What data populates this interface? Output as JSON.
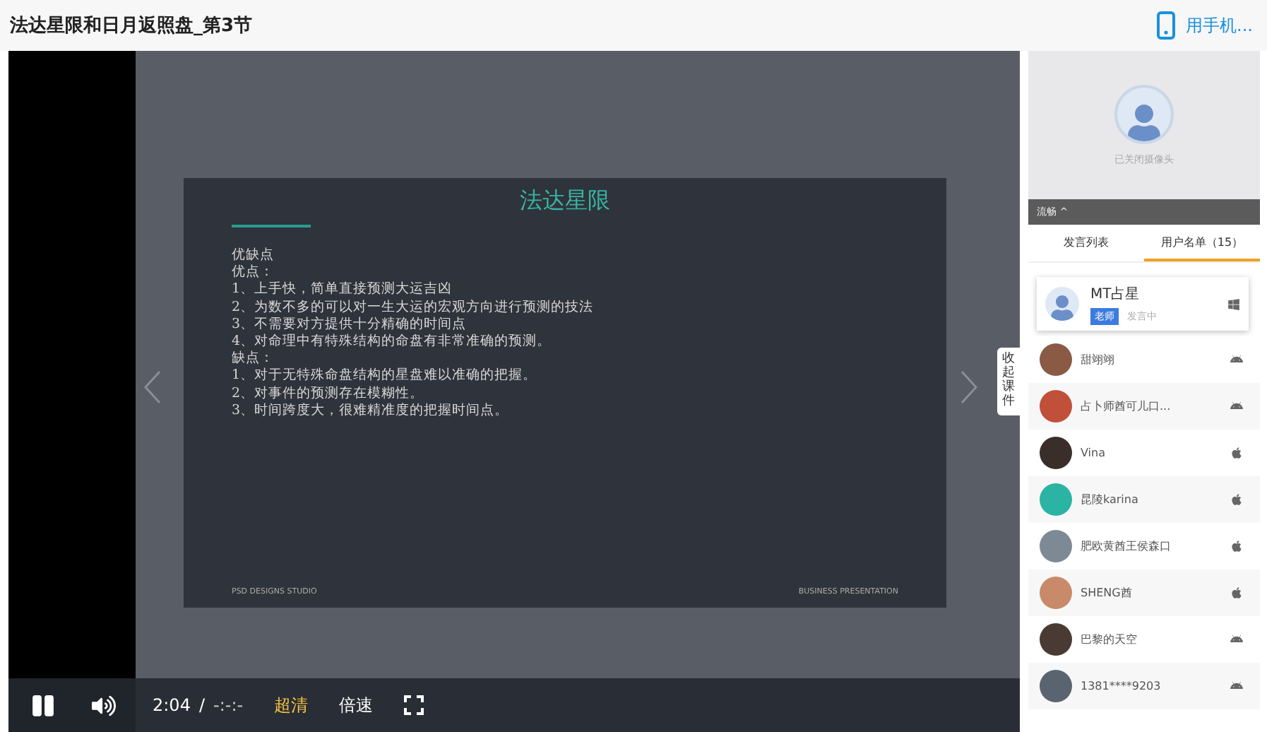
{
  "page_title": "法达星限和日月返照盘_第3节",
  "mobile_link": "用手机...",
  "slide": {
    "title": "法达星限",
    "lines": [
      "优缺点",
      "优点：",
      "1、上手快，简单直接预测大运吉凶",
      "2、为数不多的可以对一生大运的宏观方向进行预测的技法",
      "3、不需要对方提供十分精确的时间点",
      "4、对命理中有特殊结构的命盘有非常准确的预测。",
      "缺点：",
      "1、对于无特殊命盘结构的星盘难以准确的把握。",
      "2、对事件的预测存在模糊性。",
      "3、时间跨度大，很难精准度的把握时间点。"
    ],
    "footer_left": "PSD DESIGNS STUDIO",
    "footer_right": "BUSINESS PRESENTATION"
  },
  "side_tab": "收起课件",
  "panel": {
    "camera_text": "已关闭摄像头",
    "quality": "流畅 ^",
    "tabs": [
      {
        "label": "发言列表",
        "selected": false
      },
      {
        "label": "用户名单（15）",
        "selected": true
      }
    ],
    "teacher": {
      "name": "MT占星",
      "badge": "老师",
      "status": "发言中",
      "kind": "windows"
    },
    "users": [
      {
        "name": "甜翊翊",
        "kind": "android",
        "color": "#8a5a44"
      },
      {
        "name": "占卜师酋可儿口...",
        "kind": "android",
        "color": "#c0503a"
      },
      {
        "name": "Vina",
        "kind": "apple",
        "color": "#3a2e2a"
      },
      {
        "name": "昆陵karina",
        "kind": "apple",
        "color": "#2bb3a3"
      },
      {
        "name": "肥欧黄酋王侯森口",
        "kind": "apple",
        "color": "#7d8a96"
      },
      {
        "name": "SHENG酋",
        "kind": "apple",
        "color": "#c98a6a"
      },
      {
        "name": "巴黎的天空",
        "kind": "android",
        "color": "#4a3a34"
      },
      {
        "name": "1381****9203",
        "kind": "android",
        "color": "#5a6470"
      }
    ]
  },
  "player": {
    "playing": true,
    "time": "2:04",
    "separator": "/",
    "duration": "-:-:-",
    "quality": "超清",
    "speed": "倍速"
  }
}
